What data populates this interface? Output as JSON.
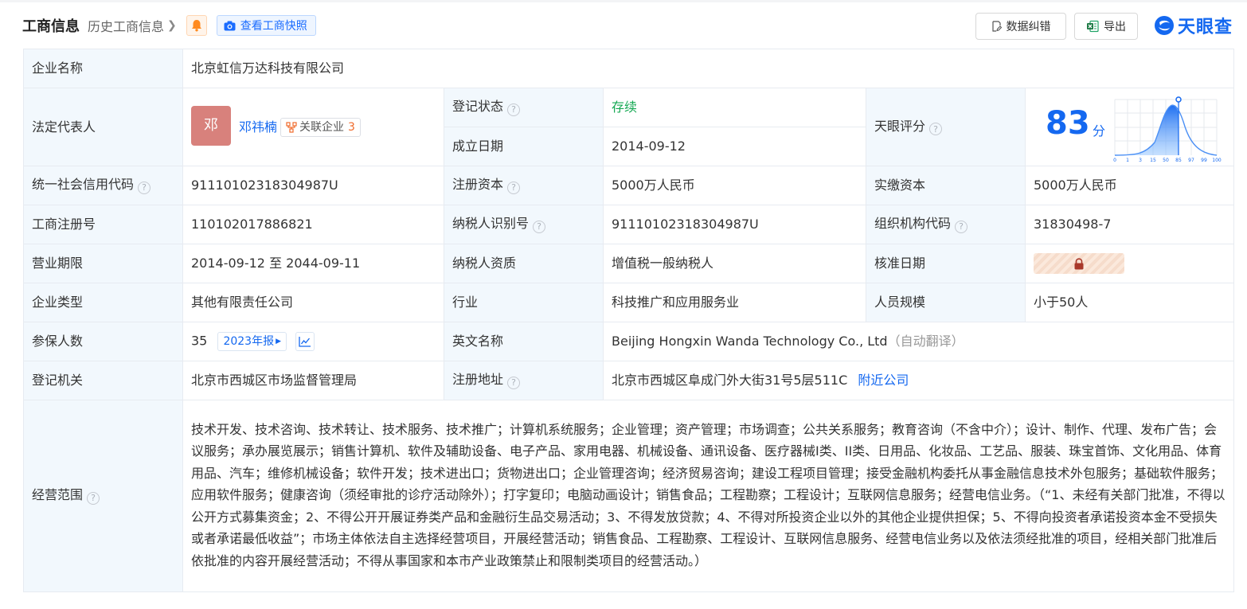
{
  "header": {
    "title": "工商信息",
    "history_link": "历史工商信息",
    "snapshot_button": "查看工商快照",
    "correct_button": "数据纠错",
    "export_button": "导出",
    "logo_text": "天眼查"
  },
  "labels": {
    "company_name": "企业名称",
    "legal_rep": "法定代表人",
    "reg_status": "登记状态",
    "found_date": "成立日期",
    "tianyan_score": "天眼评分",
    "credit_code": "统一社会信用代码",
    "reg_capital": "注册资本",
    "paid_capital": "实缴资本",
    "biz_reg_no": "工商注册号",
    "taxpayer_id": "纳税人识别号",
    "org_code": "组织机构代码",
    "biz_term": "营业期限",
    "taxpayer_quality": "纳税人资质",
    "approval_date": "核准日期",
    "company_type": "企业类型",
    "industry": "行业",
    "staff_size": "人员规模",
    "insured_count": "参保人数",
    "english_name": "英文名称",
    "reg_authority": "登记机关",
    "reg_address": "注册地址",
    "biz_scope": "经营范围"
  },
  "values": {
    "company_name": "北京虹信万达科技有限公司",
    "legal_rep_avatar": "邓",
    "legal_rep_name": "邓祎楠",
    "related_label": "关联企业",
    "related_count": "3",
    "reg_status": "存续",
    "found_date": "2014-09-12",
    "credit_code": "91110102318304987U",
    "reg_capital": "5000万人民币",
    "paid_capital": "5000万人民币",
    "biz_reg_no": "110102017886821",
    "taxpayer_id": "91110102318304987U",
    "org_code": "31830498-7",
    "biz_term": "2014-09-12 至 2044-09-11",
    "taxpayer_quality": "增值税一般纳税人",
    "company_type": "其他有限责任公司",
    "industry": "科技推广和应用服务业",
    "staff_size": "小于50人",
    "insured_count": "35",
    "annual_report": "2023年报",
    "english_name": "Beijing Hongxin Wanda Technology Co., Ltd",
    "auto_translate": "（自动翻译）",
    "reg_authority": "北京市西城区市场监督管理局",
    "reg_address": "北京市西城区阜成门外大街31号5层511C",
    "nearby_link": "附近公司",
    "biz_scope": "技术开发、技术咨询、技术转让、技术服务、技术推广；计算机系统服务；企业管理；资产管理；市场调查；公共关系服务；教育咨询（不含中介）；设计、制作、代理、发布广告；会议服务；承办展览展示；销售计算机、软件及辅助设备、电子产品、家用电器、机械设备、通讯设备、医疗器械I类、II类、日用品、化妆品、工艺品、服装、珠宝首饰、文化用品、体育用品、汽车；维修机械设备；软件开发；技术进出口；货物进出口；企业管理咨询；经济贸易咨询；建设工程项目管理；接受金融机构委托从事金融信息技术外包服务；基础软件服务；应用软件服务；健康咨询（须经审批的诊疗活动除外）；打字复印；电脑动画设计；销售食品；工程勘察；工程设计；互联网信息服务；经营电信业务。（“1、未经有关部门批准，不得以公开方式募集资金；2、不得公开开展证券类产品和金融衍生品交易活动；3、不得发放贷款；4、不得对所投资企业以外的其他企业提供担保；5、不得向投资者承诺投资本金不受损失或者承诺最低收益”；市场主体依法自主选择经营项目，开展经营活动；销售食品、工程勘察、工程设计、互联网信息服务、经营电信业务以及依法须经批准的项目，经相关部门批准后依批准的内容开展经营活动；不得从事国家和本市产业政策禁止和限制类项目的经营活动。）"
  },
  "score": {
    "value": "83",
    "unit": "分",
    "axis_ticks": [
      "0",
      "1",
      "3",
      "15",
      "50",
      "85",
      "97",
      "99",
      "100"
    ]
  },
  "colors": {
    "accent": "#1468f0",
    "status_green": "#15a853",
    "label_bg": "#f2f8fd",
    "avatar_bg": "#d8817c"
  }
}
